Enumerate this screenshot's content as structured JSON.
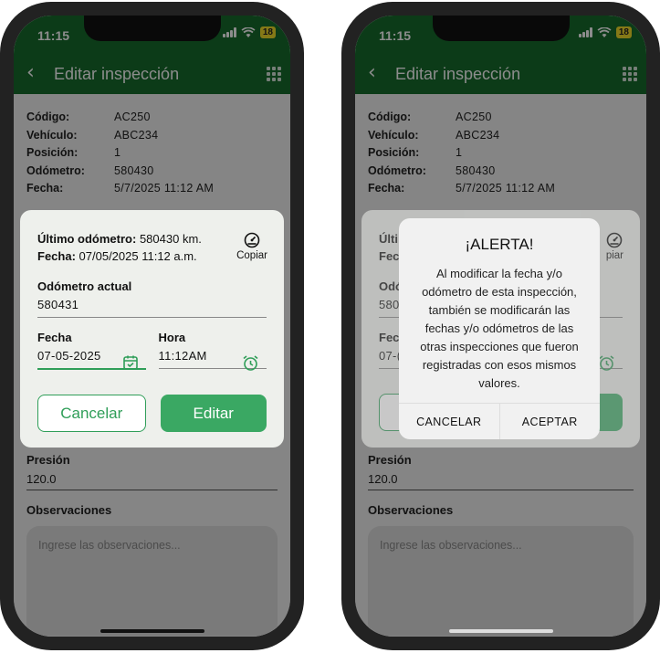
{
  "status": {
    "time": "11:15",
    "battery": "18"
  },
  "appbar": {
    "title": "Editar inspección"
  },
  "info": [
    {
      "label": "Código:",
      "value": "AC250"
    },
    {
      "label": "Vehículo:",
      "value": "ABC234"
    },
    {
      "label": "Posición:",
      "value": "1"
    },
    {
      "label": "Odómetro:",
      "value": "580430"
    },
    {
      "label": "Fecha:",
      "value": "5/7/2025 11:12 AM"
    }
  ],
  "presion": {
    "label": "Presión",
    "value": "120.0"
  },
  "observaciones": {
    "label": "Observaciones",
    "placeholder": "Ingrese las observaciones..."
  },
  "edit_dialog": {
    "last_odo_label": "Último odómetro:",
    "last_odo_value": "580430  km.",
    "last_date_label": "Fecha:",
    "last_date_value": "07/05/2025 11:12 a.m.",
    "copy_label": "Copiar",
    "odo_label": "Odómetro actual",
    "odo_value": "580431",
    "date_label": "Fecha",
    "date_value": "07-05-2025",
    "time_label": "Hora",
    "time_value": "11:12AM",
    "cancel_label": "Cancelar",
    "edit_label": "Editar"
  },
  "right_partial": {
    "last_odo_label": "Últi",
    "last_date_label": "Fec",
    "copy_label": "piar",
    "odo_label": "Odó",
    "odo_value": "580",
    "date_label": "Fec",
    "date_value": "07-("
  },
  "alert": {
    "title": "¡ALERTA!",
    "message": "Al modificar la fecha y/o odómetro de esta inspección, también se modificarán las fechas y/o odómetros de las otras inspecciones que fueron registradas con esos mismos valores.",
    "cancel_label": "CANCELAR",
    "accept_label": "ACEPTAR"
  },
  "colors": {
    "primary": "#166c2d",
    "accent": "#3aa863",
    "battery": "#f2dd2a"
  }
}
